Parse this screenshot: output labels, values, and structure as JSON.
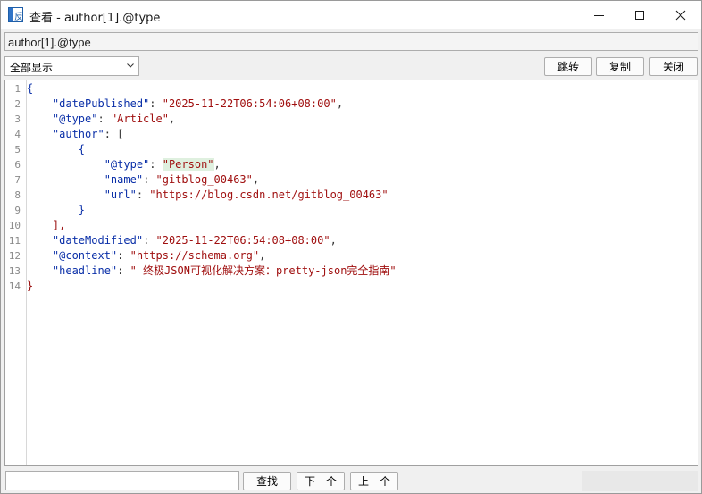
{
  "window": {
    "title": "查看 - author[1].@type",
    "app_icon_glyph": "反",
    "icons": {
      "app": "viewer-app-icon",
      "minimize": "minimize-icon",
      "maximize": "maximize-icon",
      "close": "close-icon"
    }
  },
  "path_field": {
    "value": "author[1].@type"
  },
  "toolbar": {
    "filter_select": {
      "value": "全部显示"
    },
    "jump_label": "跳转",
    "copy_label": "复制",
    "close_label": "关闭"
  },
  "editor": {
    "line_numbers": [
      "1",
      "2",
      "3",
      "4",
      "5",
      "6",
      "7",
      "8",
      "9",
      "10",
      "11",
      "12",
      "13",
      "14"
    ],
    "lines": [
      {
        "indent": "",
        "key": "",
        "sep": "",
        "value": "",
        "open": "{"
      },
      {
        "indent": "    ",
        "key": "\"datePublished\"",
        "sep": ": ",
        "value": "\"2025-11-22T06:54:06+08:00\"",
        "trail": ","
      },
      {
        "indent": "    ",
        "key": "\"@type\"",
        "sep": ": ",
        "value": "\"Article\"",
        "trail": ","
      },
      {
        "indent": "    ",
        "key": "\"author\"",
        "sep": ": ",
        "value": "",
        "open": "["
      },
      {
        "indent": "        ",
        "key": "",
        "sep": "",
        "value": "",
        "open": "{"
      },
      {
        "indent": "            ",
        "key": "\"@type\"",
        "sep": ": ",
        "value": "\"Person\"",
        "trail": ",",
        "highlight": true
      },
      {
        "indent": "            ",
        "key": "\"name\"",
        "sep": ": ",
        "value": "\"gitblog_00463\"",
        "trail": ","
      },
      {
        "indent": "            ",
        "key": "\"url\"",
        "sep": ": ",
        "value": "\"https://blog.csdn.net/gitblog_00463\"",
        "trail": ""
      },
      {
        "indent": "        ",
        "key": "",
        "sep": "",
        "value": "",
        "open": "}"
      },
      {
        "indent": "    ",
        "key": "",
        "sep": "",
        "value": "",
        "open": "],",
        "bracket_red": true
      },
      {
        "indent": "    ",
        "key": "\"dateModified\"",
        "sep": ": ",
        "value": "\"2025-11-22T06:54:08+08:00\"",
        "trail": ","
      },
      {
        "indent": "    ",
        "key": "\"@context\"",
        "sep": ": ",
        "value": "\"https://schema.org\"",
        "trail": ","
      },
      {
        "indent": "    ",
        "key": "\"headline\"",
        "sep": ": ",
        "value": "\" 终极JSON可视化解决方案：pretty-json完全指南\"",
        "trail": ""
      },
      {
        "indent": "",
        "key": "",
        "sep": "",
        "value": "",
        "open": "}",
        "bracket_red": true
      }
    ],
    "colors": {
      "key": "#0a2fa8",
      "string": "#a01010",
      "highlight": "#dff0df"
    }
  },
  "search": {
    "input_value": "",
    "find_label": "查找",
    "next_label": "下一个",
    "prev_label": "上一个"
  }
}
